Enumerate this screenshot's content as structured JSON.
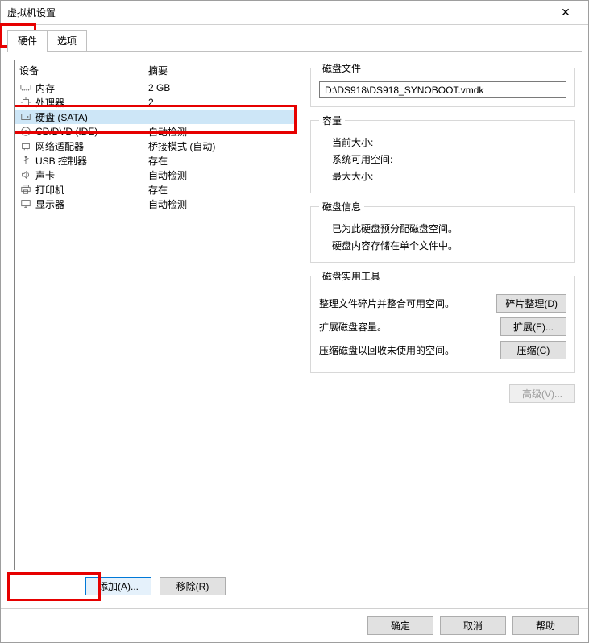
{
  "window": {
    "title": "虚拟机设置"
  },
  "tabs": {
    "hardware": "硬件",
    "options": "选项"
  },
  "deviceList": {
    "header_device": "设备",
    "header_summary": "摘要",
    "rows": [
      {
        "name": "内存",
        "summary": "2 GB"
      },
      {
        "name": "处理器",
        "summary": "2"
      },
      {
        "name": "硬盘 (SATA)",
        "summary": ""
      },
      {
        "name": "CD/DVD (IDE)",
        "summary": "自动检测"
      },
      {
        "name": "网络适配器",
        "summary": "桥接模式 (自动)"
      },
      {
        "name": "USB 控制器",
        "summary": "存在"
      },
      {
        "name": "声卡",
        "summary": "自动检测"
      },
      {
        "name": "打印机",
        "summary": "存在"
      },
      {
        "name": "显示器",
        "summary": "自动检测"
      }
    ],
    "add_btn": "添加(A)...",
    "remove_btn": "移除(R)"
  },
  "diskFile": {
    "legend": "磁盘文件",
    "path": "D:\\DS918\\DS918_SYNOBOOT.vmdk"
  },
  "capacity": {
    "legend": "容量",
    "current_size": "当前大小:",
    "free_space": "系统可用空间:",
    "max_size": "最大大小:"
  },
  "diskInfo": {
    "legend": "磁盘信息",
    "line1": "已为此硬盘预分配磁盘空间。",
    "line2": "硬盘内容存储在单个文件中。"
  },
  "diskUtil": {
    "legend": "磁盘实用工具",
    "defrag_desc": "整理文件碎片并整合可用空间。",
    "defrag_btn": "碎片整理(D)",
    "expand_desc": "扩展磁盘容量。",
    "expand_btn": "扩展(E)...",
    "compact_desc": "压缩磁盘以回收未使用的空间。",
    "compact_btn": "压缩(C)",
    "advanced_btn": "高级(V)..."
  },
  "bottom": {
    "ok": "确定",
    "cancel": "取消",
    "help": "帮助"
  }
}
